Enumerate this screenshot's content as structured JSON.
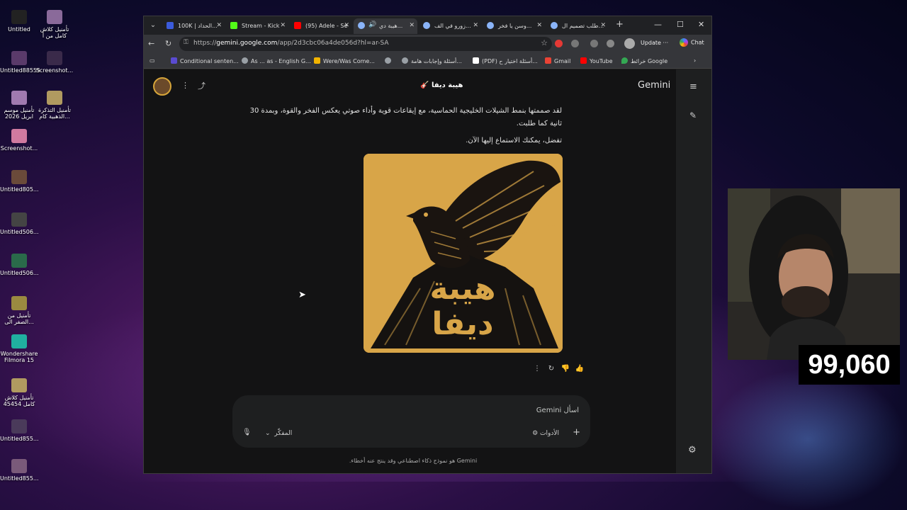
{
  "desktop": {
    "icons": [
      {
        "label": "Untitled"
      },
      {
        "label": "تأمنيل كلاش كامل من أ"
      },
      {
        "label": "Untitled88555"
      },
      {
        "label": "Screenshot..."
      },
      {
        "label": "تأمنيل موسم ابريل 2026"
      },
      {
        "label": "تأمنيل التذكرة الذهبية كام..."
      },
      {
        "label": "Screenshot..."
      },
      {
        "label": "Untitled805..."
      },
      {
        "label": "Untitled506..."
      },
      {
        "label": "Untitled506..."
      },
      {
        "label": "تأمنيل من الصفر الى..."
      },
      {
        "label": "Wondershare Filmora 15"
      },
      {
        "label": "تأمنيل كلاش كامل 45454"
      },
      {
        "label": "Untitled855..."
      },
      {
        "label": "Untitled855..."
      }
    ]
  },
  "browser": {
    "tabs": [
      {
        "label": "100K | الحداد...",
        "color": "#3b5bdb"
      },
      {
        "label": "Stream - Kick",
        "color": "#53fc18"
      },
      {
        "label": "(95) Adele - Se",
        "color": "#ff0000"
      },
      {
        "label": "هيبة دي...",
        "color": "#8ab4f8",
        "active": true
      },
      {
        "label": "زورو في الف...",
        "color": "#8ab4f8"
      },
      {
        "label": "وسن يا فخر...",
        "color": "#8ab4f8"
      },
      {
        "label": "طلب تصميم ال...",
        "color": "#8ab4f8"
      }
    ],
    "url": {
      "scheme": "https://",
      "host": "gemini.google.com",
      "path": "/app/2d3cbc06a4de056d?hl=ar-SA"
    },
    "update_label": "Update",
    "chat_label": "Chat",
    "bookmarks": [
      {
        "label": "Conditional senten...",
        "color": "#5a4bd1"
      },
      {
        "label": "As ... as - English G...",
        "color": "#9aa0a6"
      },
      {
        "label": "Were/Was Come...",
        "color": "#f2b400"
      },
      {
        "label": "",
        "color": "#9aa0a6"
      },
      {
        "label": "أسئلة وإجابات هامة...",
        "color": "#9aa0a6"
      },
      {
        "label": "(PDF) أسئلة اختيار ح...",
        "color": "#ffffff"
      },
      {
        "label": "Gmail",
        "color": "#ea4335"
      },
      {
        "label": "YouTube",
        "color": "#ff0000"
      },
      {
        "label": "خرائط Google",
        "color": "#34a853"
      }
    ]
  },
  "gemini": {
    "brand": "Gemini",
    "chat_title": "🎸 هيبة ديفا",
    "message_line1": "لقد صممتها بنمط الشيلات الخليجية الحماسية، مع إيقاعات قوية وأداء صوتي يعكس الفخر والقوة، وبمدة 30 ثانية كما طلبت.",
    "message_line2": "تفضل، يمكنك الاستماع إليها الآن.",
    "artwork_text": "هيبة ديفا",
    "input_placeholder": "اسأل Gemini",
    "tools_label": "الأدوات",
    "model_label": "المفكّر",
    "disclaimer": "Gemini هو نموذج ذكاء اصطناعي وقد ينتج عنه أخطاء."
  },
  "overlay": {
    "counter": "99,060"
  }
}
